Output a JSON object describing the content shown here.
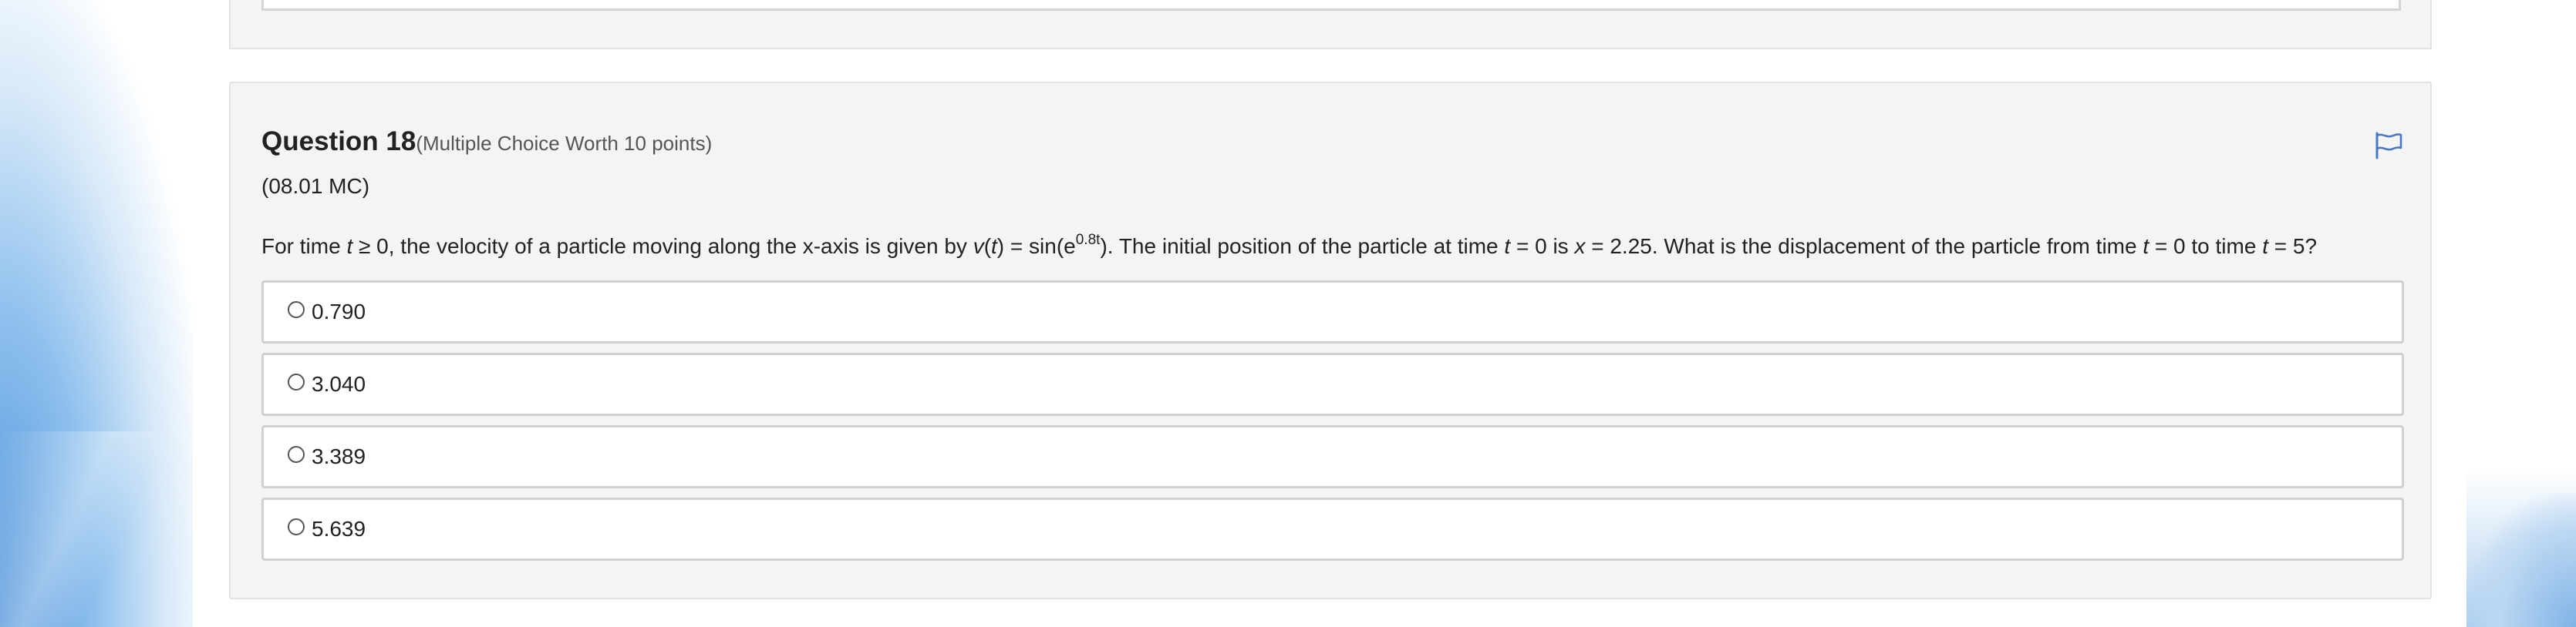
{
  "question": {
    "title": "Question 18",
    "worth": "(Multiple Choice Worth 10 points)",
    "code": "(08.01 MC)",
    "text": {
      "p1": "For time ",
      "t1": "t",
      "p2": " ≥ 0, the velocity of a particle moving along the x-axis is given by ",
      "v": "v",
      "p3": "(",
      "t2": "t",
      "p4": ") = sin(e",
      "exp": "0.8t",
      "p5": "). The initial position of the particle at time ",
      "t3": "t",
      "p6": " = 0 is ",
      "x": "x",
      "p7": " = 2.25. What is the displacement of the particle from time ",
      "t4": "t",
      "p8": " = 0 to time ",
      "t5": "t",
      "p9": " = 5?"
    },
    "choices": [
      {
        "label": "0.790",
        "selected": false
      },
      {
        "label": "3.040",
        "selected": false
      },
      {
        "label": "3.389",
        "selected": false
      },
      {
        "label": "5.639",
        "selected": false
      }
    ],
    "flag_icon": "flag-icon"
  },
  "colors": {
    "panel_bg": "#f4f4f4",
    "panel_border": "#e2e2e2",
    "choice_border": "#d0d0d0",
    "flag": "#4a78c2",
    "text": "#222222"
  }
}
